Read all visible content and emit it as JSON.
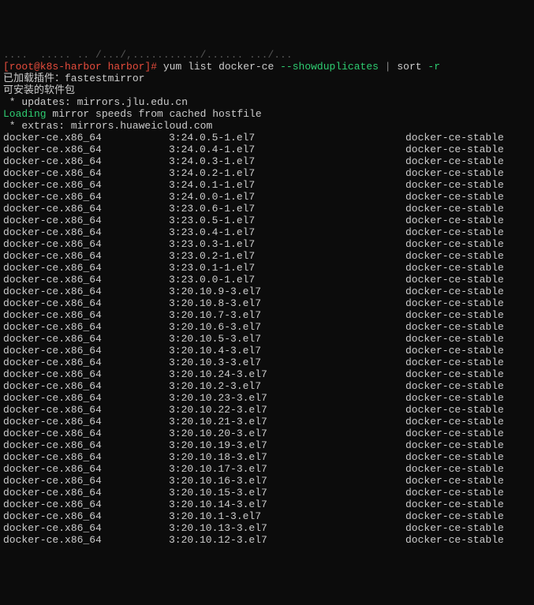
{
  "top_truncated": "....  ..... .. /.../,.........../...... .../...",
  "prompt": {
    "user_host": "[root@k8s-harbor harbor]#",
    "command": "yum list docker-ce",
    "flag1": "--showduplicates",
    "pipe1": "|",
    "sort": "sort",
    "flag2": "-r"
  },
  "lines": [
    "已加载插件：fastestmirror",
    "可安装的软件包",
    " * updates: mirrors.jlu.edu.cn"
  ],
  "loading_prefix": "Loading",
  "loading_rest": " mirror speeds from cached hostfile",
  "extras": " * extras: mirrors.huaweicloud.com",
  "packages": [
    {
      "name": "docker-ce.x86_64",
      "version": "3:24.0.5-1.el7",
      "repo": "docker-ce-stable"
    },
    {
      "name": "docker-ce.x86_64",
      "version": "3:24.0.4-1.el7",
      "repo": "docker-ce-stable"
    },
    {
      "name": "docker-ce.x86_64",
      "version": "3:24.0.3-1.el7",
      "repo": "docker-ce-stable"
    },
    {
      "name": "docker-ce.x86_64",
      "version": "3:24.0.2-1.el7",
      "repo": "docker-ce-stable"
    },
    {
      "name": "docker-ce.x86_64",
      "version": "3:24.0.1-1.el7",
      "repo": "docker-ce-stable"
    },
    {
      "name": "docker-ce.x86_64",
      "version": "3:24.0.0-1.el7",
      "repo": "docker-ce-stable"
    },
    {
      "name": "docker-ce.x86_64",
      "version": "3:23.0.6-1.el7",
      "repo": "docker-ce-stable"
    },
    {
      "name": "docker-ce.x86_64",
      "version": "3:23.0.5-1.el7",
      "repo": "docker-ce-stable"
    },
    {
      "name": "docker-ce.x86_64",
      "version": "3:23.0.4-1.el7",
      "repo": "docker-ce-stable"
    },
    {
      "name": "docker-ce.x86_64",
      "version": "3:23.0.3-1.el7",
      "repo": "docker-ce-stable"
    },
    {
      "name": "docker-ce.x86_64",
      "version": "3:23.0.2-1.el7",
      "repo": "docker-ce-stable"
    },
    {
      "name": "docker-ce.x86_64",
      "version": "3:23.0.1-1.el7",
      "repo": "docker-ce-stable"
    },
    {
      "name": "docker-ce.x86_64",
      "version": "3:23.0.0-1.el7",
      "repo": "docker-ce-stable"
    },
    {
      "name": "docker-ce.x86_64",
      "version": "3:20.10.9-3.el7",
      "repo": "docker-ce-stable"
    },
    {
      "name": "docker-ce.x86_64",
      "version": "3:20.10.8-3.el7",
      "repo": "docker-ce-stable"
    },
    {
      "name": "docker-ce.x86_64",
      "version": "3:20.10.7-3.el7",
      "repo": "docker-ce-stable"
    },
    {
      "name": "docker-ce.x86_64",
      "version": "3:20.10.6-3.el7",
      "repo": "docker-ce-stable"
    },
    {
      "name": "docker-ce.x86_64",
      "version": "3:20.10.5-3.el7",
      "repo": "docker-ce-stable"
    },
    {
      "name": "docker-ce.x86_64",
      "version": "3:20.10.4-3.el7",
      "repo": "docker-ce-stable"
    },
    {
      "name": "docker-ce.x86_64",
      "version": "3:20.10.3-3.el7",
      "repo": "docker-ce-stable"
    },
    {
      "name": "docker-ce.x86_64",
      "version": "3:20.10.24-3.el7",
      "repo": "docker-ce-stable"
    },
    {
      "name": "docker-ce.x86_64",
      "version": "3:20.10.2-3.el7",
      "repo": "docker-ce-stable"
    },
    {
      "name": "docker-ce.x86_64",
      "version": "3:20.10.23-3.el7",
      "repo": "docker-ce-stable"
    },
    {
      "name": "docker-ce.x86_64",
      "version": "3:20.10.22-3.el7",
      "repo": "docker-ce-stable"
    },
    {
      "name": "docker-ce.x86_64",
      "version": "3:20.10.21-3.el7",
      "repo": "docker-ce-stable"
    },
    {
      "name": "docker-ce.x86_64",
      "version": "3:20.10.20-3.el7",
      "repo": "docker-ce-stable"
    },
    {
      "name": "docker-ce.x86_64",
      "version": "3:20.10.19-3.el7",
      "repo": "docker-ce-stable"
    },
    {
      "name": "docker-ce.x86_64",
      "version": "3:20.10.18-3.el7",
      "repo": "docker-ce-stable"
    },
    {
      "name": "docker-ce.x86_64",
      "version": "3:20.10.17-3.el7",
      "repo": "docker-ce-stable"
    },
    {
      "name": "docker-ce.x86_64",
      "version": "3:20.10.16-3.el7",
      "repo": "docker-ce-stable"
    },
    {
      "name": "docker-ce.x86_64",
      "version": "3:20.10.15-3.el7",
      "repo": "docker-ce-stable"
    },
    {
      "name": "docker-ce.x86_64",
      "version": "3:20.10.14-3.el7",
      "repo": "docker-ce-stable"
    },
    {
      "name": "docker-ce.x86_64",
      "version": "3:20.10.1-3.el7",
      "repo": "docker-ce-stable"
    },
    {
      "name": "docker-ce.x86_64",
      "version": "3:20.10.13-3.el7",
      "repo": "docker-ce-stable"
    },
    {
      "name": "docker-ce.x86_64",
      "version": "3:20.10.12-3.el7",
      "repo": "docker-ce-stable"
    }
  ]
}
